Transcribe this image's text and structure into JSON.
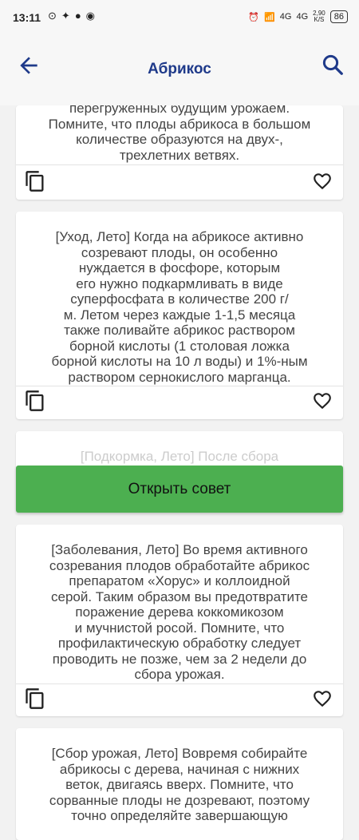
{
  "status_bar": {
    "time": "13:11",
    "battery": "86",
    "net_speed_top": "2,90",
    "net_speed_bottom": "K/S",
    "signal1": "4G",
    "signal2": "4G"
  },
  "app_bar": {
    "title": "Абрикос"
  },
  "tips": [
    {
      "lines": [
        "перегруженных будущим урожаем.",
        "Помните, что плоды абрикоса в большом",
        "количестве образуются на двух-,",
        "трехлетних ветвях."
      ]
    },
    {
      "lines": [
        "[Уход, Лето] Когда на абрикосе активно",
        "созревают плоды, он особенно",
        "нуждается в фосфоре, которым",
        "его нужно подкармливать в виде",
        "суперфосфата в количестве 200 г/",
        "м. Летом через каждые 1-1,5 месяца",
        "также поливайте абрикос раствором",
        "борной кислоты (1 столовая ложка",
        "борной кислоты на 10 л воды) и 1%-ным",
        "раствором сернокислого марганца."
      ]
    },
    {
      "lines": [
        "[Подкормка, Лето] После сбора"
      ]
    },
    {
      "lines": [
        "[Заболевания, Лето] Во время активного",
        "созревания плодов обработайте абрикос",
        "препаратом «Хорус» и коллоидной",
        "серой. Таким образом вы предотвратите",
        "поражение дерева коккомикозом",
        "и мучнистой росой. Помните, что",
        "профилактическую обработку следует",
        "проводить не позже, чем за 2 недели до",
        "сбора урожая."
      ]
    },
    {
      "lines": [
        "[Сбор урожая, Лето] Вовремя собирайте",
        "абрикосы с дерева, начиная с нижних",
        "веток, двигаясь вверх. Помните, что",
        "сорванные плоды не дозревают, поэтому",
        "точно определяйте завершающую"
      ]
    }
  ],
  "open_button": "Открыть совет",
  "icons": {
    "back": "arrow-left-icon",
    "search": "search-icon",
    "copy": "copy-icon",
    "favorite": "heart-outline-icon"
  },
  "colors": {
    "title": "#1f3a8a",
    "button": "#4caf50"
  }
}
